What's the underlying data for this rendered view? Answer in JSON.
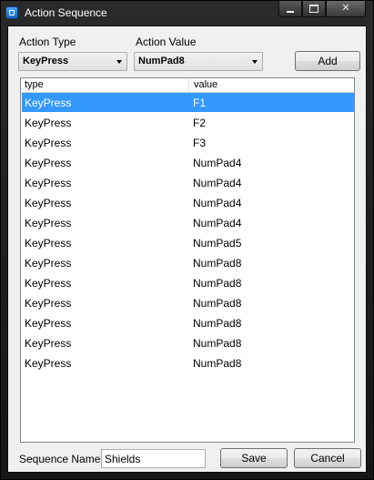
{
  "window": {
    "title": "Action Sequence",
    "caption_min": "–",
    "caption_close": "✕"
  },
  "form": {
    "action_type_label": "Action Type",
    "action_value_label": "Action Value",
    "action_type_value": "KeyPress",
    "action_value_value": "NumPad8",
    "add_label": "Add"
  },
  "list": {
    "columns": [
      "type",
      "value"
    ],
    "rows": [
      {
        "type": "KeyPress",
        "value": "F1",
        "selected": true
      },
      {
        "type": "KeyPress",
        "value": "F2"
      },
      {
        "type": "KeyPress",
        "value": "F3"
      },
      {
        "type": "KeyPress",
        "value": "NumPad4"
      },
      {
        "type": "KeyPress",
        "value": "NumPad4"
      },
      {
        "type": "KeyPress",
        "value": "NumPad4"
      },
      {
        "type": "KeyPress",
        "value": "NumPad4"
      },
      {
        "type": "KeyPress",
        "value": "NumPad5"
      },
      {
        "type": "KeyPress",
        "value": "NumPad8"
      },
      {
        "type": "KeyPress",
        "value": "NumPad8"
      },
      {
        "type": "KeyPress",
        "value": "NumPad8"
      },
      {
        "type": "KeyPress",
        "value": "NumPad8"
      },
      {
        "type": "KeyPress",
        "value": "NumPad8"
      },
      {
        "type": "KeyPress",
        "value": "NumPad8"
      }
    ]
  },
  "footer": {
    "sequence_name_label": "Sequence Name",
    "sequence_name_value": "Shields",
    "save_label": "Save",
    "cancel_label": "Cancel"
  },
  "colors": {
    "selection": "#3399ff",
    "client_bg": "#f0f0f0",
    "frame_bg": "#1c1c1c"
  },
  "icons": {
    "app": "app-window-icon",
    "minimize": "minimize-icon",
    "maximize": "maximize-icon",
    "close": "close-icon",
    "dropdown": "chevron-down-icon"
  }
}
